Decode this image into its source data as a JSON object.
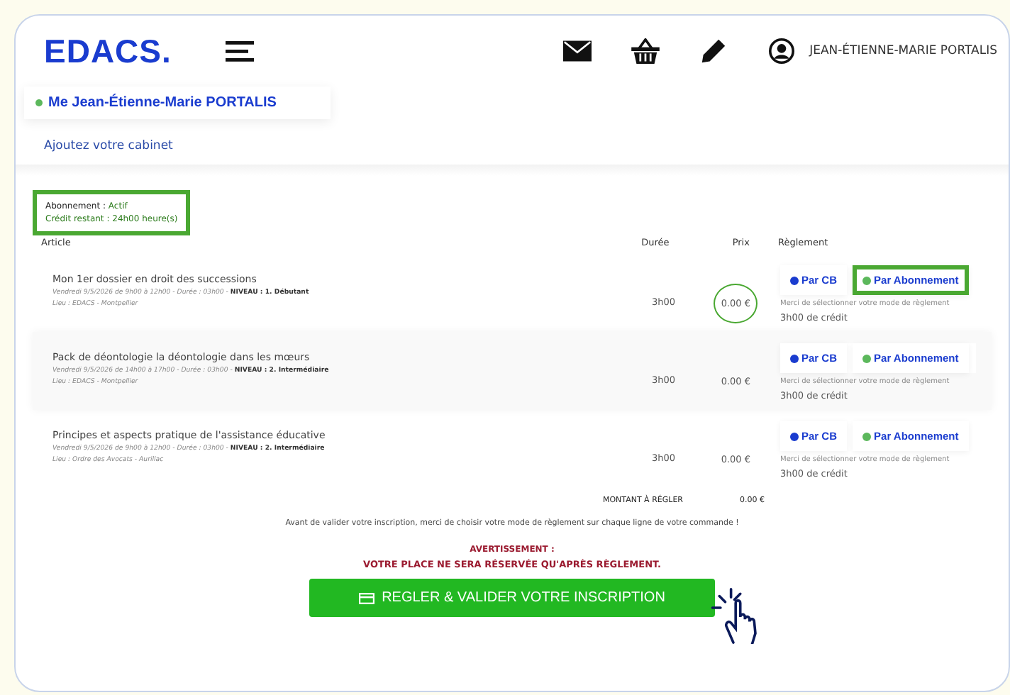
{
  "header": {
    "logo": "EDACS.",
    "user_name": "JEAN-ÉTIENNE-MARIE PORTALIS"
  },
  "account": {
    "name": "Me Jean-Étienne-Marie PORTALIS",
    "online": true,
    "link": "Ajoutez votre cabinet"
  },
  "subscription": {
    "status_label": "Abonnement :",
    "status": "Actif",
    "credit_label": "Crédit restant :",
    "credit": "24h00 heure(s)",
    "highlighted": true
  },
  "table": {
    "columns": [
      "Article",
      "Durée",
      "Prix",
      "Règlement"
    ],
    "rows": [
      {
        "title": "Mon 1er dossier en droit des successions",
        "details": "Vendredi 9/5/2026 de 9h00 à 12h00 - Durée : 03h00 - ",
        "level": "NIVEAU : 1. Débutant",
        "place": "Lieu : EDACS - Montpellier",
        "duration": "3h00",
        "price": "0.00 €",
        "options": [
          {
            "label": "Par CB",
            "color": "#1a3ccf",
            "highlighted": false
          },
          {
            "label": "Par Abonnement",
            "color": "#5cb85c",
            "highlighted": true
          }
        ],
        "note": "Merci de sélectionner votre mode de règlement",
        "credit": "3h00 de crédit",
        "price_circled": true
      },
      {
        "title": "Pack de déontologie la déontologie dans les mœurs",
        "details": "Vendredi 9/5/2026 de 14h00 à 17h00 - Durée : 03h00 - ",
        "level": "NIVEAU : 2. Intermédiaire",
        "place": "Lieu : EDACS - Montpellier",
        "duration": "3h00",
        "price": "0.00 €",
        "options": [
          {
            "label": "Par CB",
            "color": "#1a3ccf",
            "highlighted": false
          },
          {
            "label": "Par Abonnement",
            "color": "#5cb85c",
            "highlighted": false
          }
        ],
        "note": "Merci de sélectionner votre mode de règlement",
        "credit": "3h00 de crédit",
        "price_circled": false
      },
      {
        "title": "Principes et aspects pratique de l'assistance éducative",
        "details": "Vendredi 9/5/2026 de 9h00 à 12h00 - Durée : 03h00 - ",
        "level": "NIVEAU : 2. Intermédiaire",
        "place": "Lieu : Ordre des Avocats - Aurillac",
        "duration": "3h00",
        "price": "0.00 €",
        "options": [
          {
            "label": "Par CB",
            "color": "#1a3ccf",
            "highlighted": false
          },
          {
            "label": "Par Abonnement",
            "color": "#5cb85c",
            "highlighted": false
          }
        ],
        "note": "Merci de sélectionner votre mode de règlement",
        "credit": "3h00 de crédit",
        "price_circled": false
      }
    ]
  },
  "total": {
    "label": "MONTANT À RÉGLER",
    "value": "0.00 €"
  },
  "instruction": "Avant de valider votre inscription, merci de choisir votre mode de règlement sur chaque ligne de votre commande !",
  "warning": {
    "title": "AVERTISSEMENT :",
    "text": "VOTRE PLACE NE SERA RÉSERVÉE QU'APRÈS RÈGLEMENT."
  },
  "submit_button": "REGLER & VALIDER VOTRE INSCRIPTION"
}
